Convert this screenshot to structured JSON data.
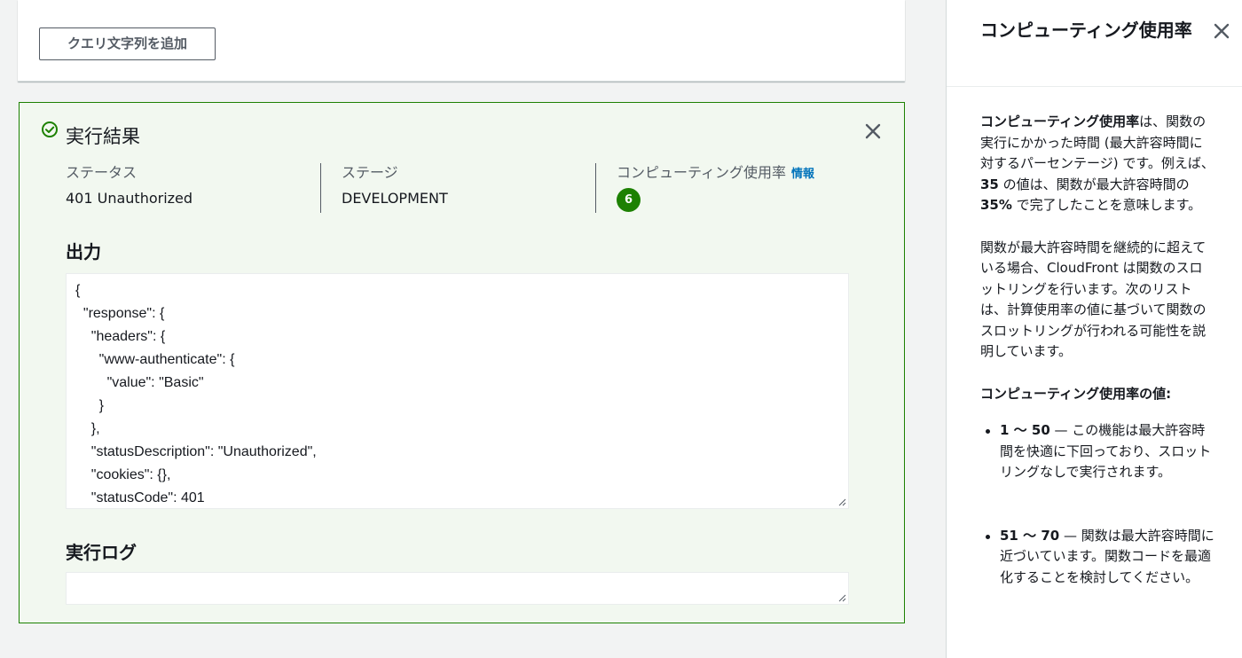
{
  "query": {
    "add_button": "クエリ文字列を追加"
  },
  "result": {
    "title": "実行結果",
    "status": {
      "label": "ステータス",
      "value": "401 Unauthorized"
    },
    "stage": {
      "label": "ステージ",
      "value": "DEVELOPMENT"
    },
    "usage": {
      "label": "コンピューティング使用率",
      "info": "情報",
      "value": "6"
    },
    "output_heading": "出力",
    "output_text": "{\n  \"response\": {\n    \"headers\": {\n      \"www-authenticate\": {\n        \"value\": \"Basic\"\n      }\n    },\n    \"statusDescription\": \"Unauthorized\",\n    \"cookies\": {},\n    \"statusCode\": 401",
    "log_heading": "実行ログ",
    "log_text": ""
  },
  "help": {
    "title": "コンピューティング使用率",
    "p1_bold": "コンピューティング使用率",
    "p1_text": "は、関数の実行にかかった時間 (最大許容時間に対するパーセンテージ) です。例えば、",
    "p1_b2": "35",
    "p1_text2": " の値は、関数が最大許容時間の ",
    "p1_b3": "35%",
    "p1_text3": " で完了したことを意味します。",
    "p2": "関数が最大許容時間を継続的に超えている場合、CloudFront は関数のスロットリングを行います。次のリストは、計算使用率の値に基づいて関数のスロットリングが行われる可能性を説明しています。",
    "values_heading": "コンピューティング使用率の値:",
    "items": [
      {
        "range": "1 〜 50",
        "text": " — この機能は最大許容時間を快適に下回っており、スロットリングなしで実行されます。"
      },
      {
        "range": "51 〜 70",
        "text": " — 関数は最大許容時間に近づいています。関数コードを最適化することを検討してください。"
      }
    ]
  },
  "colors": {
    "success": "#1d8102",
    "link": "#0073bb",
    "panel_bg": "#f2f8f0"
  }
}
